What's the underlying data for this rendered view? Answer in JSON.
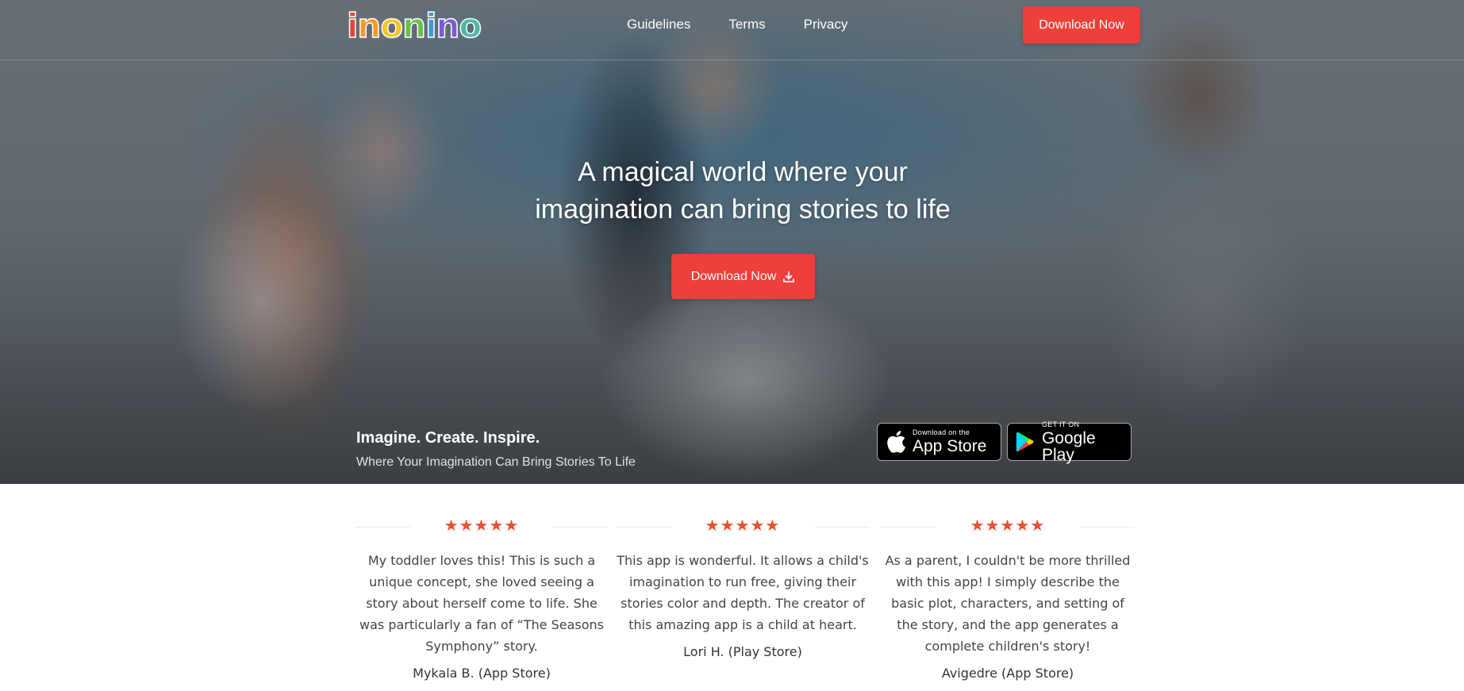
{
  "brand": {
    "logo_letters": [
      {
        "ch": "i",
        "color": "#e7453b"
      },
      {
        "ch": "n",
        "color": "#f29a2e"
      },
      {
        "ch": "o",
        "color": "#f2c82e"
      },
      {
        "ch": "n",
        "color": "#6cbf4a"
      },
      {
        "ch": "i",
        "color": "#3c9ad9"
      },
      {
        "ch": "n",
        "color": "#7b5bd6"
      },
      {
        "ch": "o",
        "color": "#4bb8a9"
      }
    ],
    "accent_color": "#ee3f3a",
    "star_color": "#e8512f"
  },
  "nav": {
    "links": [
      "Guidelines",
      "Terms",
      "Privacy"
    ],
    "download_label": "Download Now"
  },
  "hero": {
    "headline_line1": "A magical world where your",
    "headline_line2": "imagination can bring stories to life",
    "download_label": "Download Now",
    "download_icon": "download-icon",
    "tagline": "Imagine. Create. Inspire.",
    "subtagline": "Where Your Imagination Can Bring Stories To Life"
  },
  "badges": {
    "apple": {
      "small": "Download on the",
      "big": "App Store",
      "icon": "apple-icon"
    },
    "google": {
      "small": "GET IT ON",
      "big": "Google Play",
      "icon": "google-play-icon"
    }
  },
  "reviews": [
    {
      "stars": "★★★★★",
      "text": "My toddler loves this! This is such a unique concept, she loved seeing a story about herself come to life. She was particularly a fan of “The Seasons Symphony” story.",
      "author": "Mykala B. (App Store)"
    },
    {
      "stars": "★★★★★",
      "text": "This app is wonderful. It allows a child's imagination to run free, giving their stories color and depth. The creator of this amazing app is a child at heart.",
      "author": "Lori H. (Play Store)"
    },
    {
      "stars": "★★★★★",
      "text": "As a parent, I couldn't be more thrilled with this app! I simply describe the basic plot, characters, and setting of the story, and the app generates a complete children's story!",
      "author": "Avigedre (App Store)"
    }
  ]
}
